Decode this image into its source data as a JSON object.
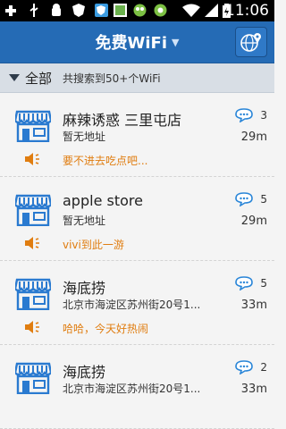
{
  "status_bar": {
    "time": "11:06",
    "icons": [
      "plus-icon",
      "usb-icon",
      "android-icon",
      "shield-icon",
      "image-icon",
      "app-icon",
      "app2-icon",
      "wifi-icon",
      "signal-icon",
      "battery-icon"
    ]
  },
  "header": {
    "title": "免费WiFi"
  },
  "filter": {
    "scope": "全部",
    "result": "共搜索到50+个WiFi"
  },
  "colors": {
    "header": "#256bb5",
    "accent_orange": "#e07d10",
    "icon_blue": "#2a7ad0"
  },
  "items": [
    {
      "name": "麻辣诱惑 三里屯店",
      "address": "暂无地址",
      "message": "要不进去吃点吧...",
      "comments": "3",
      "distance": "29m"
    },
    {
      "name": "apple store",
      "address": "暂无地址",
      "message": "vivi到此一游",
      "comments": "5",
      "distance": "29m"
    },
    {
      "name": "海底捞",
      "address": "北京市海淀区苏州街20号1...",
      "message": "哈哈，今天好热闹",
      "comments": "5",
      "distance": "33m"
    },
    {
      "name": "海底捞",
      "address": "北京市海淀区苏州街20号1...",
      "message": "",
      "comments": "2",
      "distance": "33m"
    }
  ]
}
